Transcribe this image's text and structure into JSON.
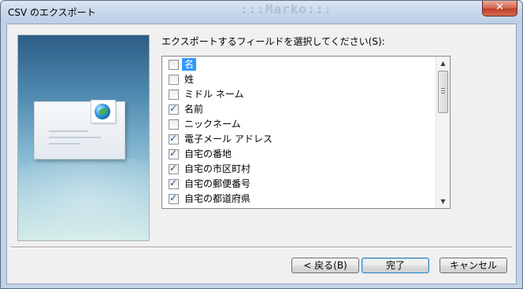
{
  "window": {
    "title": "CSV のエクスポート",
    "ghost_text": ":::Marko:::",
    "close_glyph": "✕"
  },
  "dialog": {
    "prompt": "エクスポートするフィールドを選択してください(S):",
    "fields": [
      {
        "label": "名",
        "checked": false,
        "selected": true
      },
      {
        "label": "姓",
        "checked": false,
        "selected": false
      },
      {
        "label": "ミドル ネーム",
        "checked": false,
        "selected": false
      },
      {
        "label": "名前",
        "checked": true,
        "selected": false
      },
      {
        "label": "ニックネーム",
        "checked": false,
        "selected": false
      },
      {
        "label": "電子メール アドレス",
        "checked": true,
        "selected": false
      },
      {
        "label": "自宅の番地",
        "checked": true,
        "selected": false
      },
      {
        "label": "自宅の市区町村",
        "checked": true,
        "selected": false
      },
      {
        "label": "自宅の郵便番号",
        "checked": true,
        "selected": false
      },
      {
        "label": "自宅の都道府県",
        "checked": true,
        "selected": false
      }
    ]
  },
  "buttons": {
    "back": "< 戻る(B)",
    "finish": "完了",
    "cancel": "キャンセル"
  },
  "colors": {
    "selection": "#3399ff",
    "close": "#c0412b"
  },
  "icons": {
    "side_image": "envelope-with-globe-icon",
    "check": "checkmark-icon"
  }
}
